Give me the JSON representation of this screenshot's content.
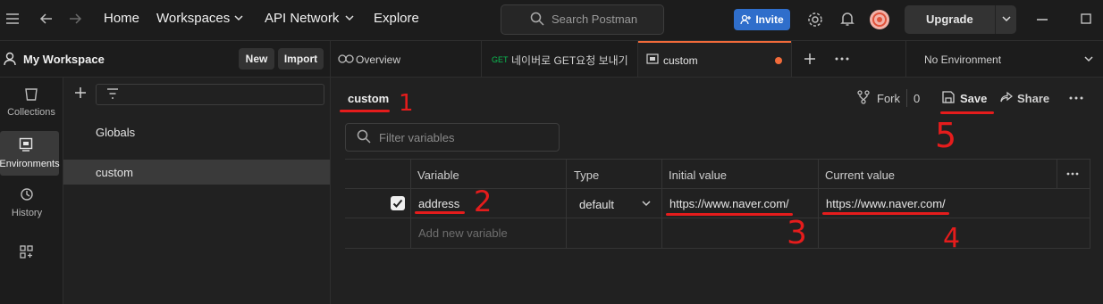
{
  "topbar": {
    "nav": [
      "Home",
      "Workspaces",
      "API Network",
      "Explore"
    ],
    "search_placeholder": "Search Postman",
    "invite_label": "Invite",
    "upgrade_label": "Upgrade"
  },
  "workspace": {
    "title": "My Workspace",
    "new_label": "New",
    "import_label": "Import"
  },
  "rail": {
    "items": [
      {
        "label": "Collections",
        "icon": "collections-icon"
      },
      {
        "label": "Environments",
        "icon": "environments-icon"
      },
      {
        "label": "History",
        "icon": "history-icon"
      },
      {
        "label": "",
        "icon": "apps-icon"
      }
    ]
  },
  "sidebar": {
    "items": [
      {
        "label": "Globals"
      },
      {
        "label": "custom"
      }
    ]
  },
  "tabs": {
    "items": [
      {
        "label": "Overview",
        "method": ""
      },
      {
        "label": "네이버로 GET요청 보내기",
        "method": "GET"
      },
      {
        "label": "custom",
        "method": ""
      }
    ],
    "environment": "No Environment"
  },
  "env": {
    "name": "custom",
    "fork_label": "Fork",
    "fork_count": "0",
    "save_label": "Save",
    "share_label": "Share",
    "filter_placeholder": "Filter variables"
  },
  "table": {
    "headers": [
      "Variable",
      "Type",
      "Initial value",
      "Current value"
    ],
    "rows": [
      {
        "variable": "address",
        "type": "default",
        "initial": "https://www.naver.com/",
        "current": "https://www.naver.com/",
        "enabled": true
      }
    ],
    "add_placeholder": "Add new variable"
  },
  "annotations": [
    "1",
    "2",
    "3",
    "4",
    "5"
  ],
  "colors": {
    "accent_blue": "#2f6ecb",
    "tab_dot": "#f26b3a",
    "annotation_red": "#e51c1c",
    "get_method": "#0cbb52"
  }
}
